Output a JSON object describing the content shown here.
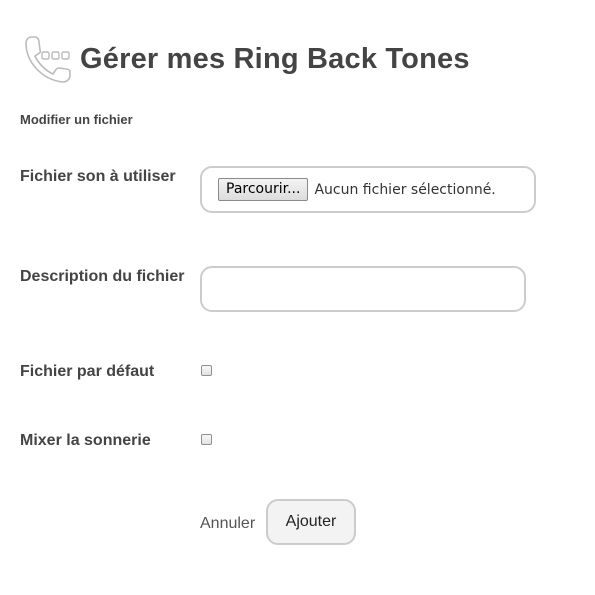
{
  "header": {
    "title": "Gérer mes Ring Back Tones",
    "icon": "phone-keypad-icon"
  },
  "form": {
    "subtitle": "Modifier un fichier",
    "file_field": {
      "label": "Fichier son à utiliser",
      "browse_label": "Parcourir...",
      "status": "Aucun fichier sélectionné."
    },
    "description_field": {
      "label": "Description du fichier",
      "value": "",
      "placeholder": ""
    },
    "default_file": {
      "label": "Fichier par défaut",
      "checked": false
    },
    "mix_ringtone": {
      "label": "Mixer la sonnerie",
      "checked": false
    },
    "actions": {
      "cancel_label": "Annuler",
      "submit_label": "Ajouter"
    }
  },
  "colors": {
    "text": "#444444",
    "border": "#cccccc",
    "icon": "#bbbbbb"
  }
}
